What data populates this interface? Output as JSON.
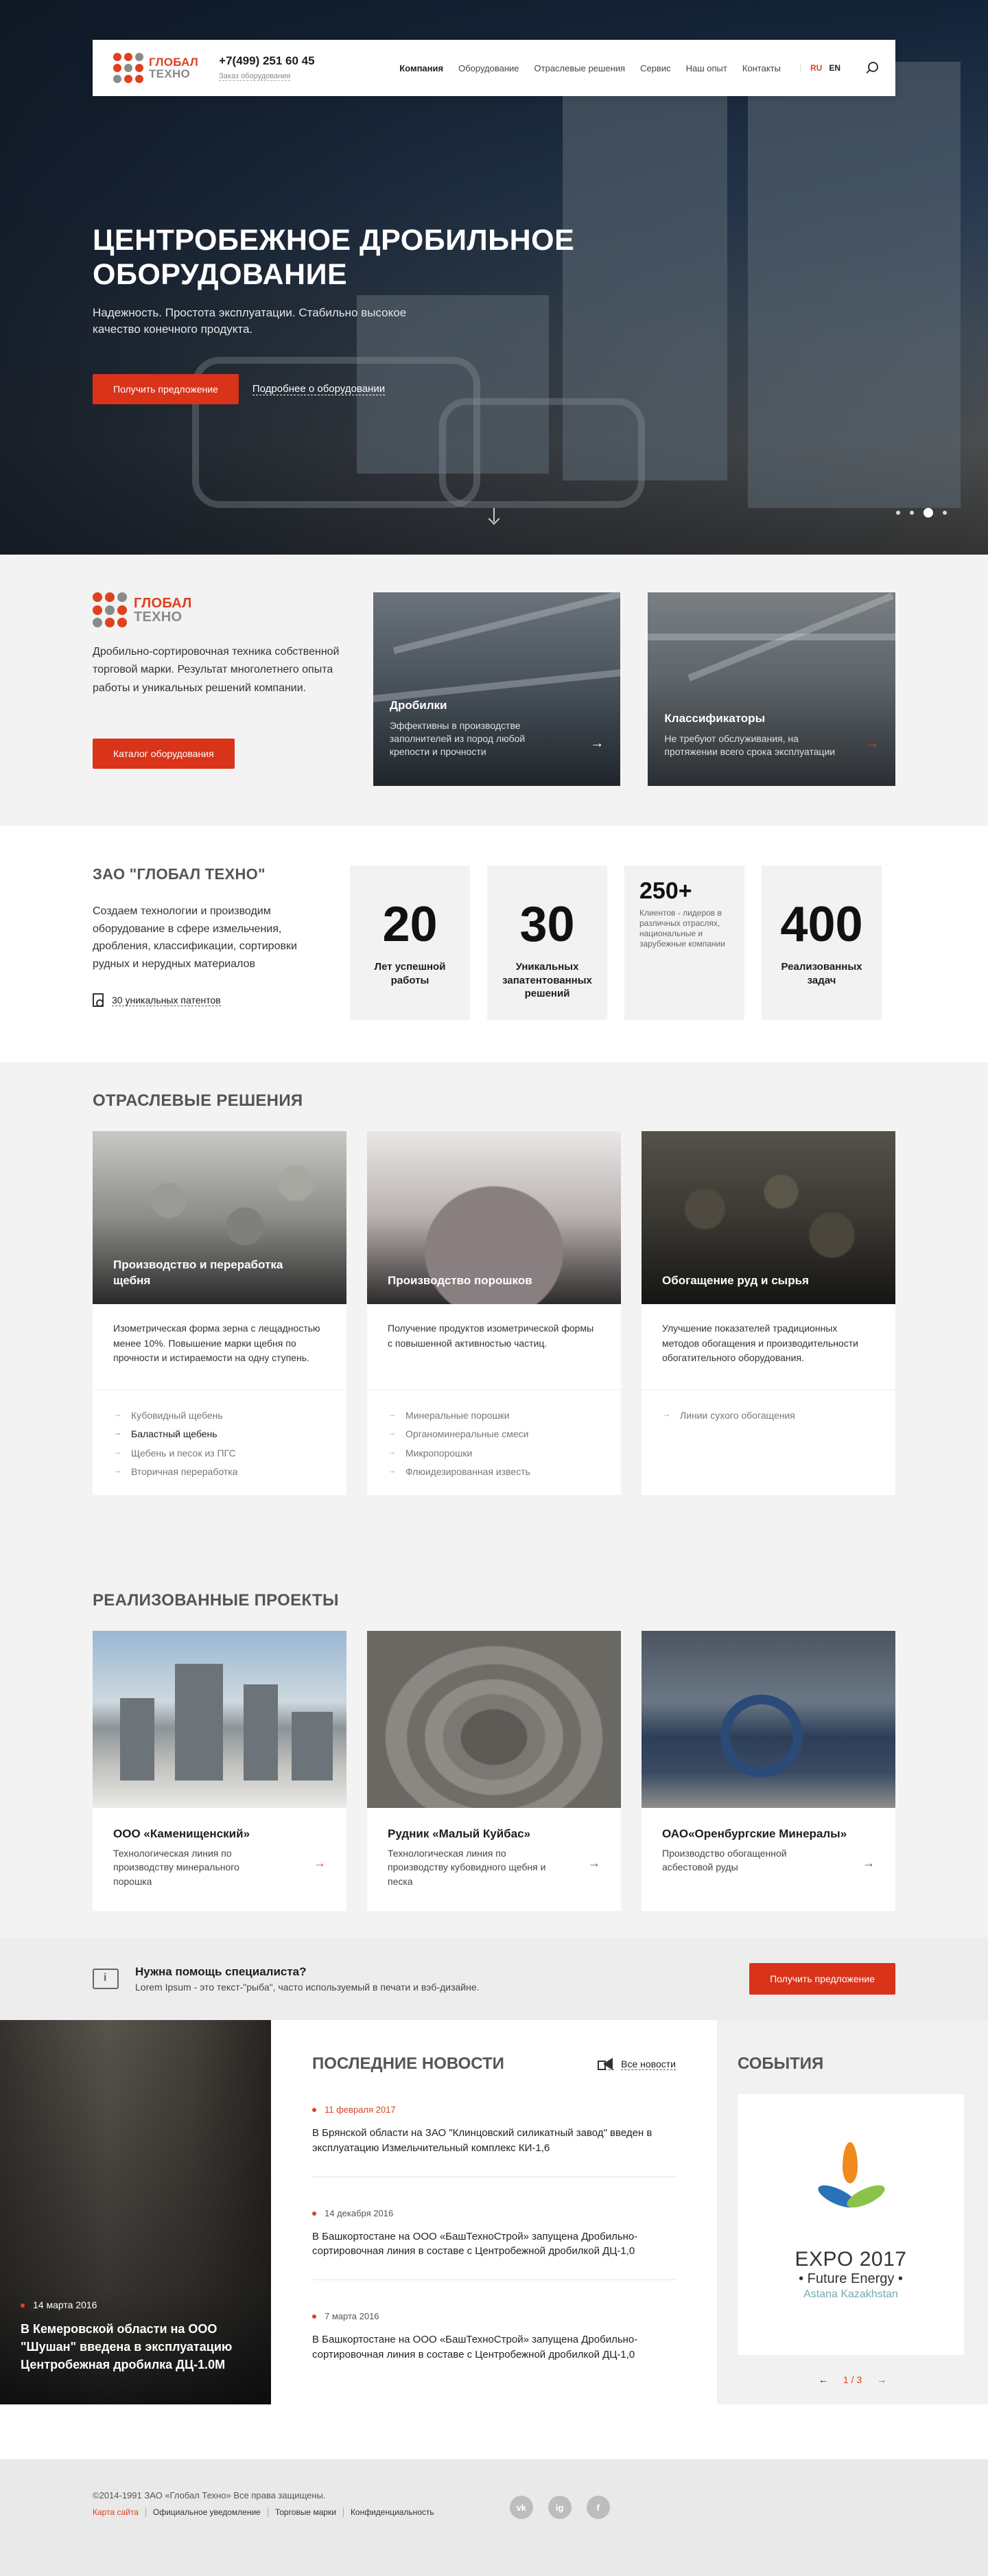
{
  "header": {
    "logo_line1": "ГЛОБАЛ",
    "logo_line2": "ТЕХНО",
    "phone": "+7(499) 251 60 45",
    "order_link": "Заказ оборудования",
    "menu": [
      "Компания",
      "Оборудование",
      "Отраслевые решения",
      "Сервис",
      "Наш опыт",
      "Контакты"
    ],
    "lang_ru": "RU",
    "lang_en": "EN"
  },
  "hero": {
    "title_line1": "ЦЕНТРОБЕЖНОЕ ДРОБИЛЬНОЕ",
    "title_line2": "ОБОРУДОВАНИЕ",
    "subtitle": "Надежность. Простота эксплуатации. Стабильно высокое качество конечного продукта.",
    "cta": "Получить предложение",
    "more": "Подробнее о оборудовании"
  },
  "about": {
    "logo_line1": "ГЛОБАЛ",
    "logo_line2": "ТЕХНО",
    "text": "Дробильно-сортировочная техника собственной торговой марки. Результат многолетнего опыта работы и уникальных решений компании.",
    "catalog_button": "Каталог оборудования",
    "cards": [
      {
        "title": "Дробилки",
        "text": "Эффективны в производстве заполнителей из пород любой крепости и прочности"
      },
      {
        "title": "Классификаторы",
        "text": "Не требуют обслуживания, на протяжении всего срока эксплуатации"
      }
    ]
  },
  "stats": {
    "title": "ЗАО \"ГЛОБАЛ ТЕХНО\"",
    "text": "Создаем технологии и производим оборудование в сфере измельчения, дробления, классификации, сортировки рудных и нерудных материалов",
    "patents": "30 уникальных патентов",
    "items": [
      {
        "num": "20",
        "label": "Лет успешной работы"
      },
      {
        "num": "30",
        "label": "Уникальных запатентованных решений"
      },
      {
        "num": "250+",
        "label": "Клиентов - лидеров в различных отраслях, национальные и зарубежные компании"
      },
      {
        "num": "400",
        "label": "Реализованных задач"
      }
    ]
  },
  "industry": {
    "title": "ОТРАСЛЕВЫЕ РЕШЕНИЯ",
    "cards": [
      {
        "title": "Производство и переработка щебня",
        "desc": "Изометрическая форма зерна с лещадностью менее 10%. Повышение марки щебня по прочности и истираемости на одну ступень.",
        "items": [
          "Кубовидный щебень",
          "Баластный щебень",
          "Щебень и песок из ПГС",
          "Вторичная переработка"
        ]
      },
      {
        "title": "Производство порошков",
        "desc": "Получение продуктов изометрической формы с повышенной активностью частиц.",
        "items": [
          "Минеральные порошки",
          "Органоминеральные смеси",
          "Микропорошки",
          "Флюидезированная известь"
        ]
      },
      {
        "title": "Обогащение руд и сырья",
        "desc": "Улучшение показателей традиционных методов обогащения и производительности обогатительного оборудования.",
        "items": [
          "Линии сухого обогащения"
        ]
      }
    ]
  },
  "projects": {
    "title": "РЕАЛИЗОВАННЫЕ ПРОЕКТЫ",
    "cards": [
      {
        "title": "ООО «Каменищенский»",
        "text": "Технологическая линия по производству минерального порошка"
      },
      {
        "title": "Рудник «Малый Куйбас»",
        "text": "Технологическая линия по производству кубовидного щебня и песка"
      },
      {
        "title": "ОАО«Оренбургские Минералы»",
        "text": "Производство обогащенной асбестовой руды"
      }
    ]
  },
  "help": {
    "title": "Нужна помощь специалиста?",
    "text": "Lorem Ipsum - это текст-\"рыба\", часто используемый в печати и вэб-дизайне.",
    "cta": "Получить предложение"
  },
  "news": {
    "feature_date": "14 марта 2016",
    "feature_title": "В Кемеровской области на ООО \"Шушан\" введена в эксплуатацию Центробежная дробилка ДЦ-1.0М",
    "title": "ПОСЛЕДНИЕ НОВОСТИ",
    "all": "Все новости",
    "items": [
      {
        "date": "11 февраля 2017",
        "text": "В Брянской области на ЗАО \"Клинцовский силикатный завод\" введен в эксплуатацию Измельчительный комплекс КИ-1,6"
      },
      {
        "date": "14 декабря 2016",
        "text": "В Башкортостане на ООО «БашТехноСтрой» запущена Дробильно-сортировочная линия в составе с Центробежной дробилкой ДЦ-1,0"
      },
      {
        "date": "7 марта 2016",
        "text": "В Башкортостане на ООО «БашТехноСтрой» запущена Дробильно-сортировочная линия в составе с Центробежной дробилкой ДЦ-1,0"
      }
    ]
  },
  "events": {
    "title": "СОБЫТИЯ",
    "expo1": "EXPO 2017",
    "expo2": "• Future Energy •",
    "expo3": "Astana Kazakhstan",
    "pager": "1 / 3"
  },
  "footer": {
    "copyright": "©2014-1991 ЗАО «Глобал Техно» Все права защищены.",
    "links": [
      "Карта сайта",
      "Официальное уведомление",
      "Торговые марки",
      "Конфиденциальность"
    ],
    "socials": [
      "vk",
      "ig",
      "f"
    ]
  }
}
